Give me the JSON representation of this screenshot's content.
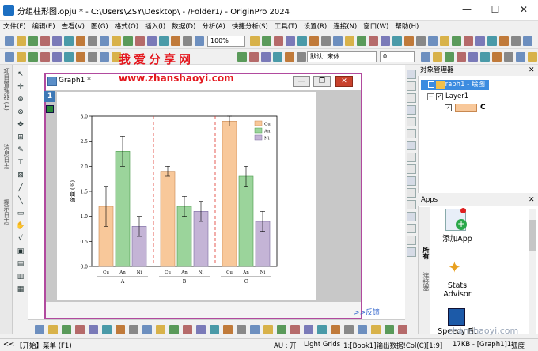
{
  "window": {
    "title": "分组柱形图.opju * - C:\\Users\\ZSY\\Desktop\\ - /Folder1/ - OriginPro 2024",
    "minimize": "—",
    "maximize": "☐",
    "close": "✕"
  },
  "menu": [
    "文件(F)",
    "编辑(E)",
    "查看(V)",
    "图(G)",
    "格式(O)",
    "插入(I)",
    "数据(D)",
    "分析(A)",
    "快捷分析(S)",
    "工具(T)",
    "设置(R)",
    "连接(N)",
    "窗口(W)",
    "帮助(H)"
  ],
  "toolbar": {
    "zoom": "100%",
    "font": "默认: 宋体",
    "font_size": "0"
  },
  "watermark": {
    "cn": "我爱分享网",
    "url": "www.zhanshaoyi.com",
    "bottom": "zhanshaoyi.com"
  },
  "left_tabs": [
    "项目管理器 (1)",
    "消息日志",
    "提示日志"
  ],
  "graph_window": {
    "title": "Graph1 *",
    "layer_number": "1"
  },
  "feedback_link": ">>反馈",
  "object_manager": {
    "header": "对象管理器",
    "graph_item": "Graph1 - 绘图",
    "layer_item": "Layer1",
    "plot_item": "C"
  },
  "apps": {
    "header": "Apps",
    "side_tabs": [
      "所有",
      "连接器"
    ],
    "items": [
      {
        "label": "添加App",
        "icon": "add-app-icon"
      },
      {
        "label": "Stats Advisor",
        "icon": "stats-advisor-icon"
      },
      {
        "label": "Speedy Fit",
        "icon": "speedy-fit-icon"
      }
    ]
  },
  "status": {
    "start": "【开始】菜单 (F1)",
    "au": "AU : 开",
    "grids": "Light Grids",
    "book": "1:[Book1]输出数据!Col(C)[1:9]",
    "mem": "17KB - [Graph1]1!",
    "angle": "弧度"
  },
  "colors": {
    "cu": "#f8c89a",
    "an": "#9bd49b",
    "ni": "#c4b4d6",
    "divider": "#e0342c",
    "graph_border": "#b14a9e"
  },
  "chart_data": {
    "type": "bar",
    "ylabel": "含量 (%)",
    "ylim": [
      0,
      3.0
    ],
    "yticks": [
      0.0,
      0.5,
      1.0,
      1.5,
      2.0,
      2.5,
      3.0
    ],
    "groups": [
      "A",
      "B",
      "C"
    ],
    "categories": [
      "Cu",
      "An",
      "Ni"
    ],
    "legend": [
      "Cu",
      "An",
      "Ni"
    ],
    "legend_position": "top-right",
    "series": [
      {
        "group": "A",
        "values": [
          1.2,
          2.3,
          0.8
        ],
        "errors": [
          0.4,
          0.3,
          0.2
        ]
      },
      {
        "group": "B",
        "values": [
          1.9,
          1.2,
          1.1
        ],
        "errors": [
          0.1,
          0.2,
          0.2
        ]
      },
      {
        "group": "C",
        "values": [
          2.9,
          1.8,
          0.9
        ],
        "errors": [
          0.1,
          0.2,
          0.2
        ]
      }
    ]
  }
}
